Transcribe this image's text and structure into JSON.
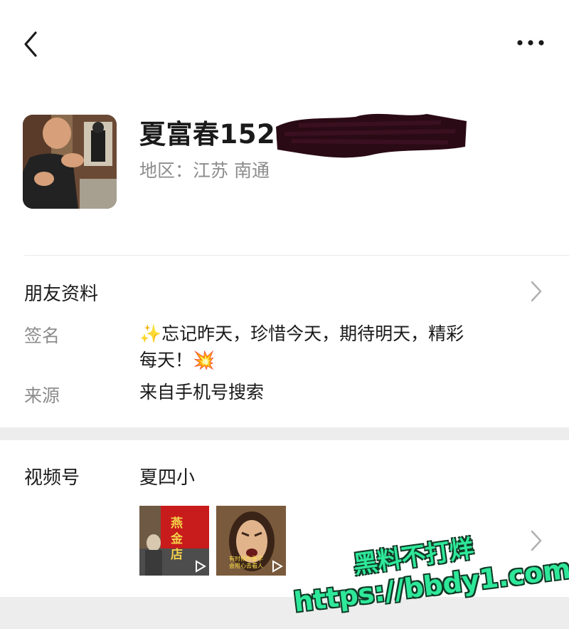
{
  "nav": {
    "back_icon": "chevron-left-icon",
    "more_icon": "ellipsis-icon"
  },
  "profile": {
    "name": "夏富春15240589999",
    "region": "地区：江苏 南通"
  },
  "friend_info": {
    "title": "朋友资料",
    "signature_label": "签名",
    "signature_line1": "✨忘记昨天，珍惜今天，期待明天，精彩",
    "signature_line2": "每天！💥",
    "source_label": "来源",
    "source_value": "来自手机号搜索"
  },
  "channels": {
    "label": "视频号",
    "name": "夏四小",
    "thumb1_text": "燕金店",
    "thumb2_text": "有时候你要学会用心去看人"
  },
  "watermark": {
    "line1": "黑料不打烊",
    "line2": "https://bbdy1.com",
    "color": "#2ee89a"
  }
}
